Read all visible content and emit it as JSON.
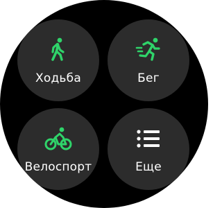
{
  "tiles": [
    {
      "label": "Ходьба",
      "icon": "walking-icon"
    },
    {
      "label": "Бег",
      "icon": "running-icon"
    },
    {
      "label": "Велоспорт",
      "icon": "cycling-icon"
    },
    {
      "label": "Еще",
      "icon": "more-list-icon"
    }
  ],
  "colors": {
    "accent": "#2fd46a",
    "tile": "#2c2c2c",
    "background": "#000000",
    "text": "#ffffff"
  }
}
